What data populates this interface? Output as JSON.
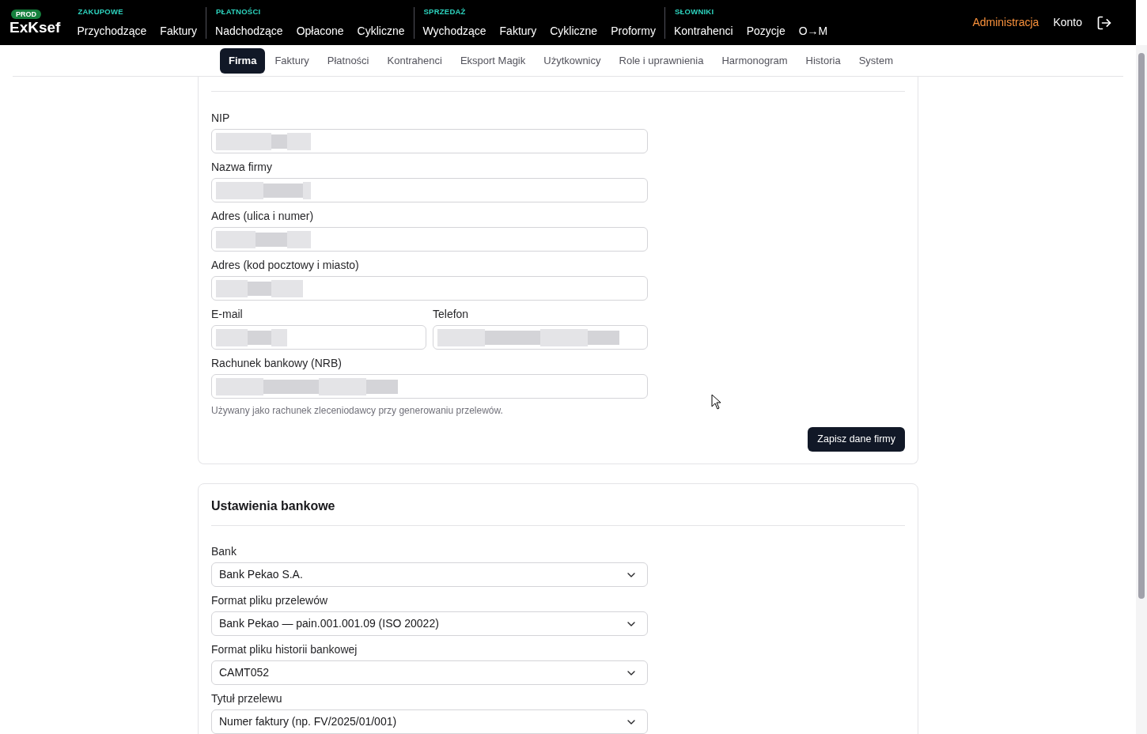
{
  "brand": {
    "badge": "PROD",
    "name": "ExKsef"
  },
  "nav_groups": [
    {
      "label": "ZAKUPOWE",
      "items": [
        {
          "label": "Przychodzące",
          "selected": false
        },
        {
          "label": "Faktury",
          "selected": false
        }
      ]
    },
    {
      "label": "PŁATNOŚCI",
      "items": [
        {
          "label": "Nadchodzące",
          "selected": false
        },
        {
          "label": "Opłacone",
          "selected": false
        },
        {
          "label": "Cykliczne",
          "selected": false
        }
      ]
    },
    {
      "label": "SPRZEDAŻ",
      "items": [
        {
          "label": "Wychodzące",
          "selected": false
        },
        {
          "label": "Faktury",
          "selected": false
        },
        {
          "label": "Cykliczne",
          "selected": false
        },
        {
          "label": "Proformy",
          "selected": false
        }
      ]
    },
    {
      "label": "SŁOWNIKI",
      "items": [
        {
          "label": "Kontrahenci",
          "selected": false
        },
        {
          "label": "Pozycje",
          "selected": false
        },
        {
          "label": "O→M",
          "selected": false
        }
      ]
    }
  ],
  "nav_right": [
    {
      "label": "Administracja",
      "selected": true
    },
    {
      "label": "Konto",
      "selected": false
    }
  ],
  "tabs": [
    {
      "label": "Firma",
      "selected": true
    },
    {
      "label": "Faktury",
      "selected": false
    },
    {
      "label": "Płatności",
      "selected": false
    },
    {
      "label": "Kontrahenci",
      "selected": false
    },
    {
      "label": "Eksport Magik",
      "selected": false
    },
    {
      "label": "Użytkownicy",
      "selected": false
    },
    {
      "label": "Role i uprawnienia",
      "selected": false
    },
    {
      "label": "Harmonogram",
      "selected": false
    },
    {
      "label": "Historia",
      "selected": false
    },
    {
      "label": "System",
      "selected": false
    }
  ],
  "company_card": {
    "rows": [
      [
        {
          "label": "NIP",
          "redacted": true
        }
      ],
      [
        {
          "label": "Nazwa firmy",
          "redacted": true
        }
      ],
      [
        {
          "label": "Adres (ulica i numer)",
          "redacted": true
        }
      ],
      [
        {
          "label": "Adres (kod pocztowy i miasto)",
          "redacted": true
        }
      ],
      [
        {
          "label": "E-mail",
          "redacted": true
        },
        {
          "label": "Telefon",
          "redacted": true
        }
      ],
      [
        {
          "label": "Rachunek bankowy (NRB)",
          "redacted": true,
          "help": "Używany jako rachunek zleceniodawcy przy generowaniu przelewów."
        }
      ]
    ],
    "save_button": "Zapisz dane firmy"
  },
  "bank_card": {
    "title": "Ustawienia bankowe",
    "selects": [
      {
        "label": "Bank",
        "value": "Bank Pekao S.A."
      },
      {
        "label": "Format pliku przelewów",
        "value": "Bank Pekao — pain.001.001.09 (ISO 20022)"
      },
      {
        "label": "Format pliku historii bankowej",
        "value": "CAMT052"
      },
      {
        "label": "Tytuł przelewu",
        "value": "Numer faktury (np. FV/2025/01/001)"
      }
    ]
  }
}
